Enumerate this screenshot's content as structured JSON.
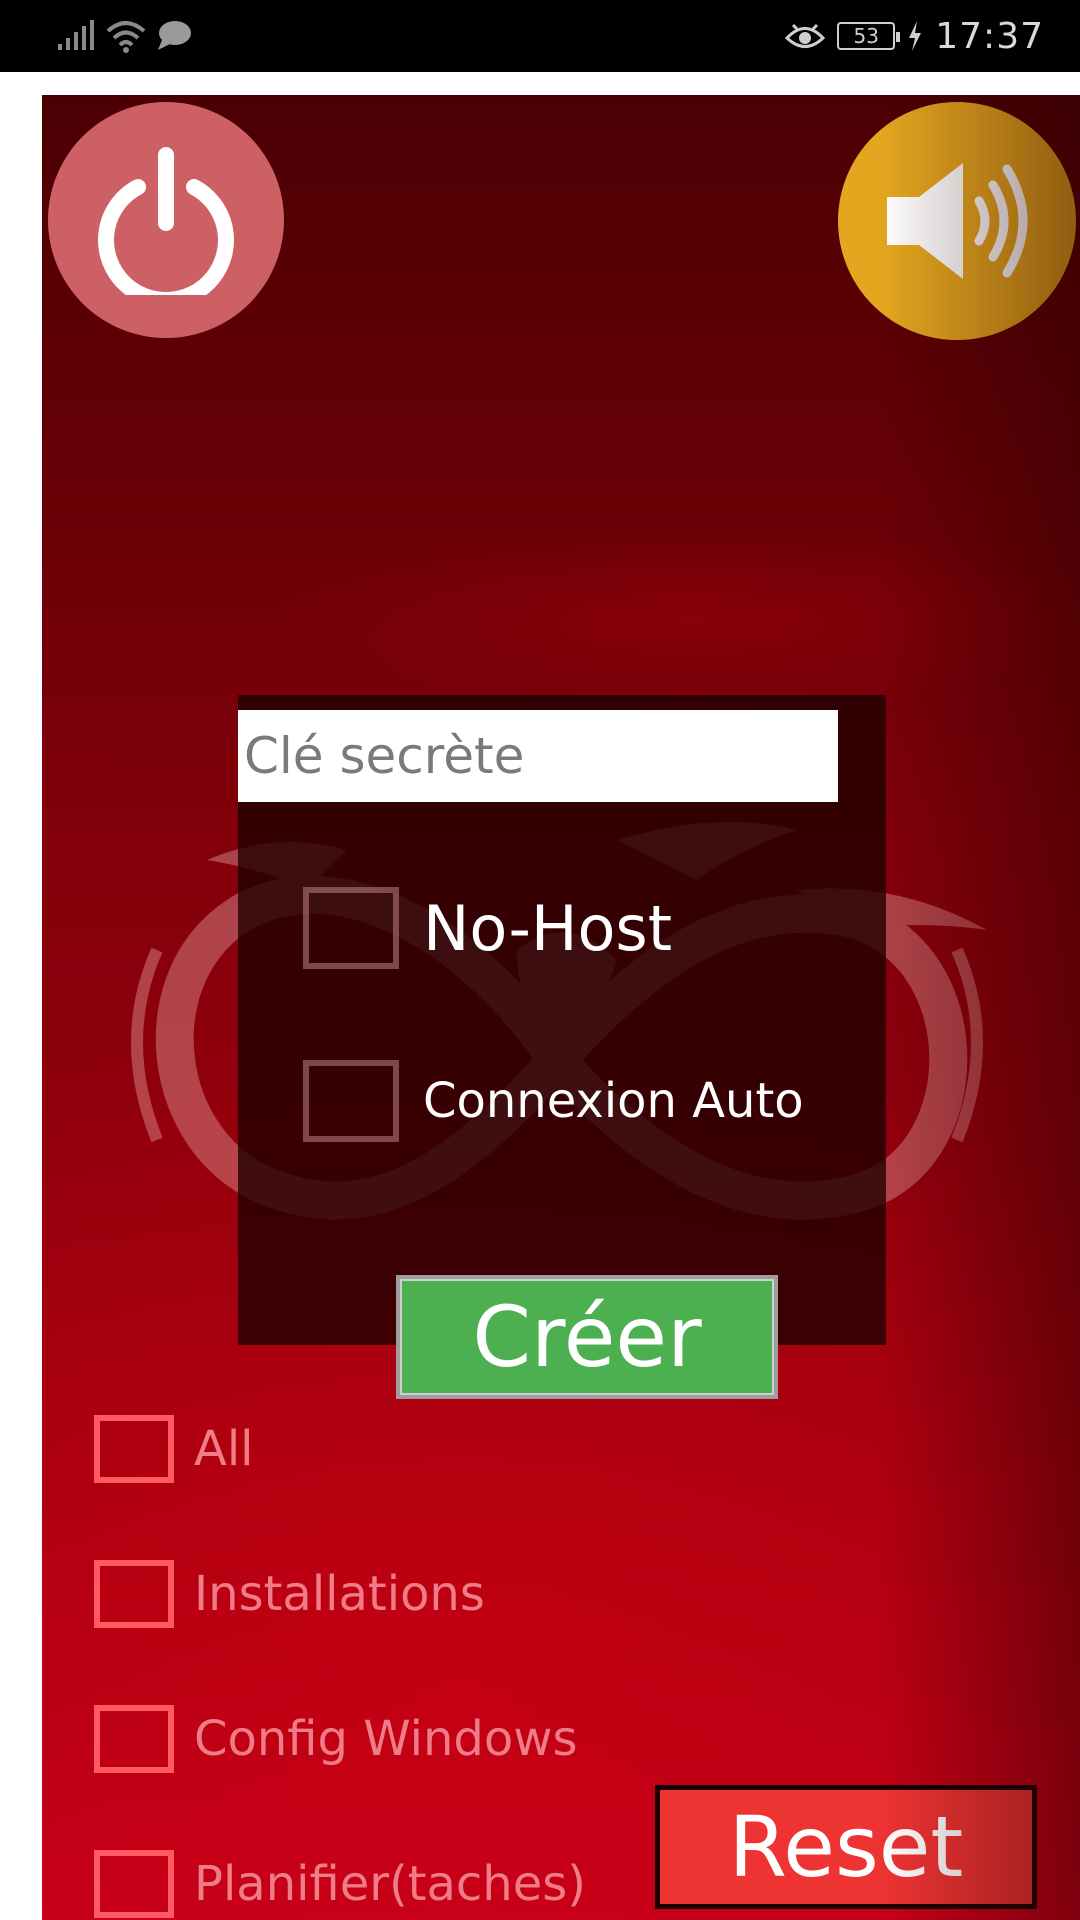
{
  "status_bar": {
    "time": "17:37",
    "battery_level": "53",
    "icons": [
      "signal-icon",
      "wifi-icon",
      "message-icon",
      "eye-icon",
      "battery-icon",
      "charging-icon"
    ]
  },
  "top_buttons": {
    "power_icon": "power-icon",
    "sound_icon": "speaker-icon",
    "power_color": "#cd6064",
    "sound_color": "#e3a61e"
  },
  "panel": {
    "secret_placeholder": "Clé secrète",
    "secret_value": "",
    "no_host_label": "No-Host",
    "auto_connect_label": "Connexion Auto",
    "create_label": "Créer",
    "create_color": "#4caf50"
  },
  "options": {
    "items": [
      {
        "label": "All",
        "checked": false
      },
      {
        "label": "Installations",
        "checked": false
      },
      {
        "label": "Config Windows",
        "checked": false
      },
      {
        "label": "Planifier(taches)",
        "checked": false
      }
    ]
  },
  "reset": {
    "label": "Reset",
    "color": "#ee3333"
  }
}
